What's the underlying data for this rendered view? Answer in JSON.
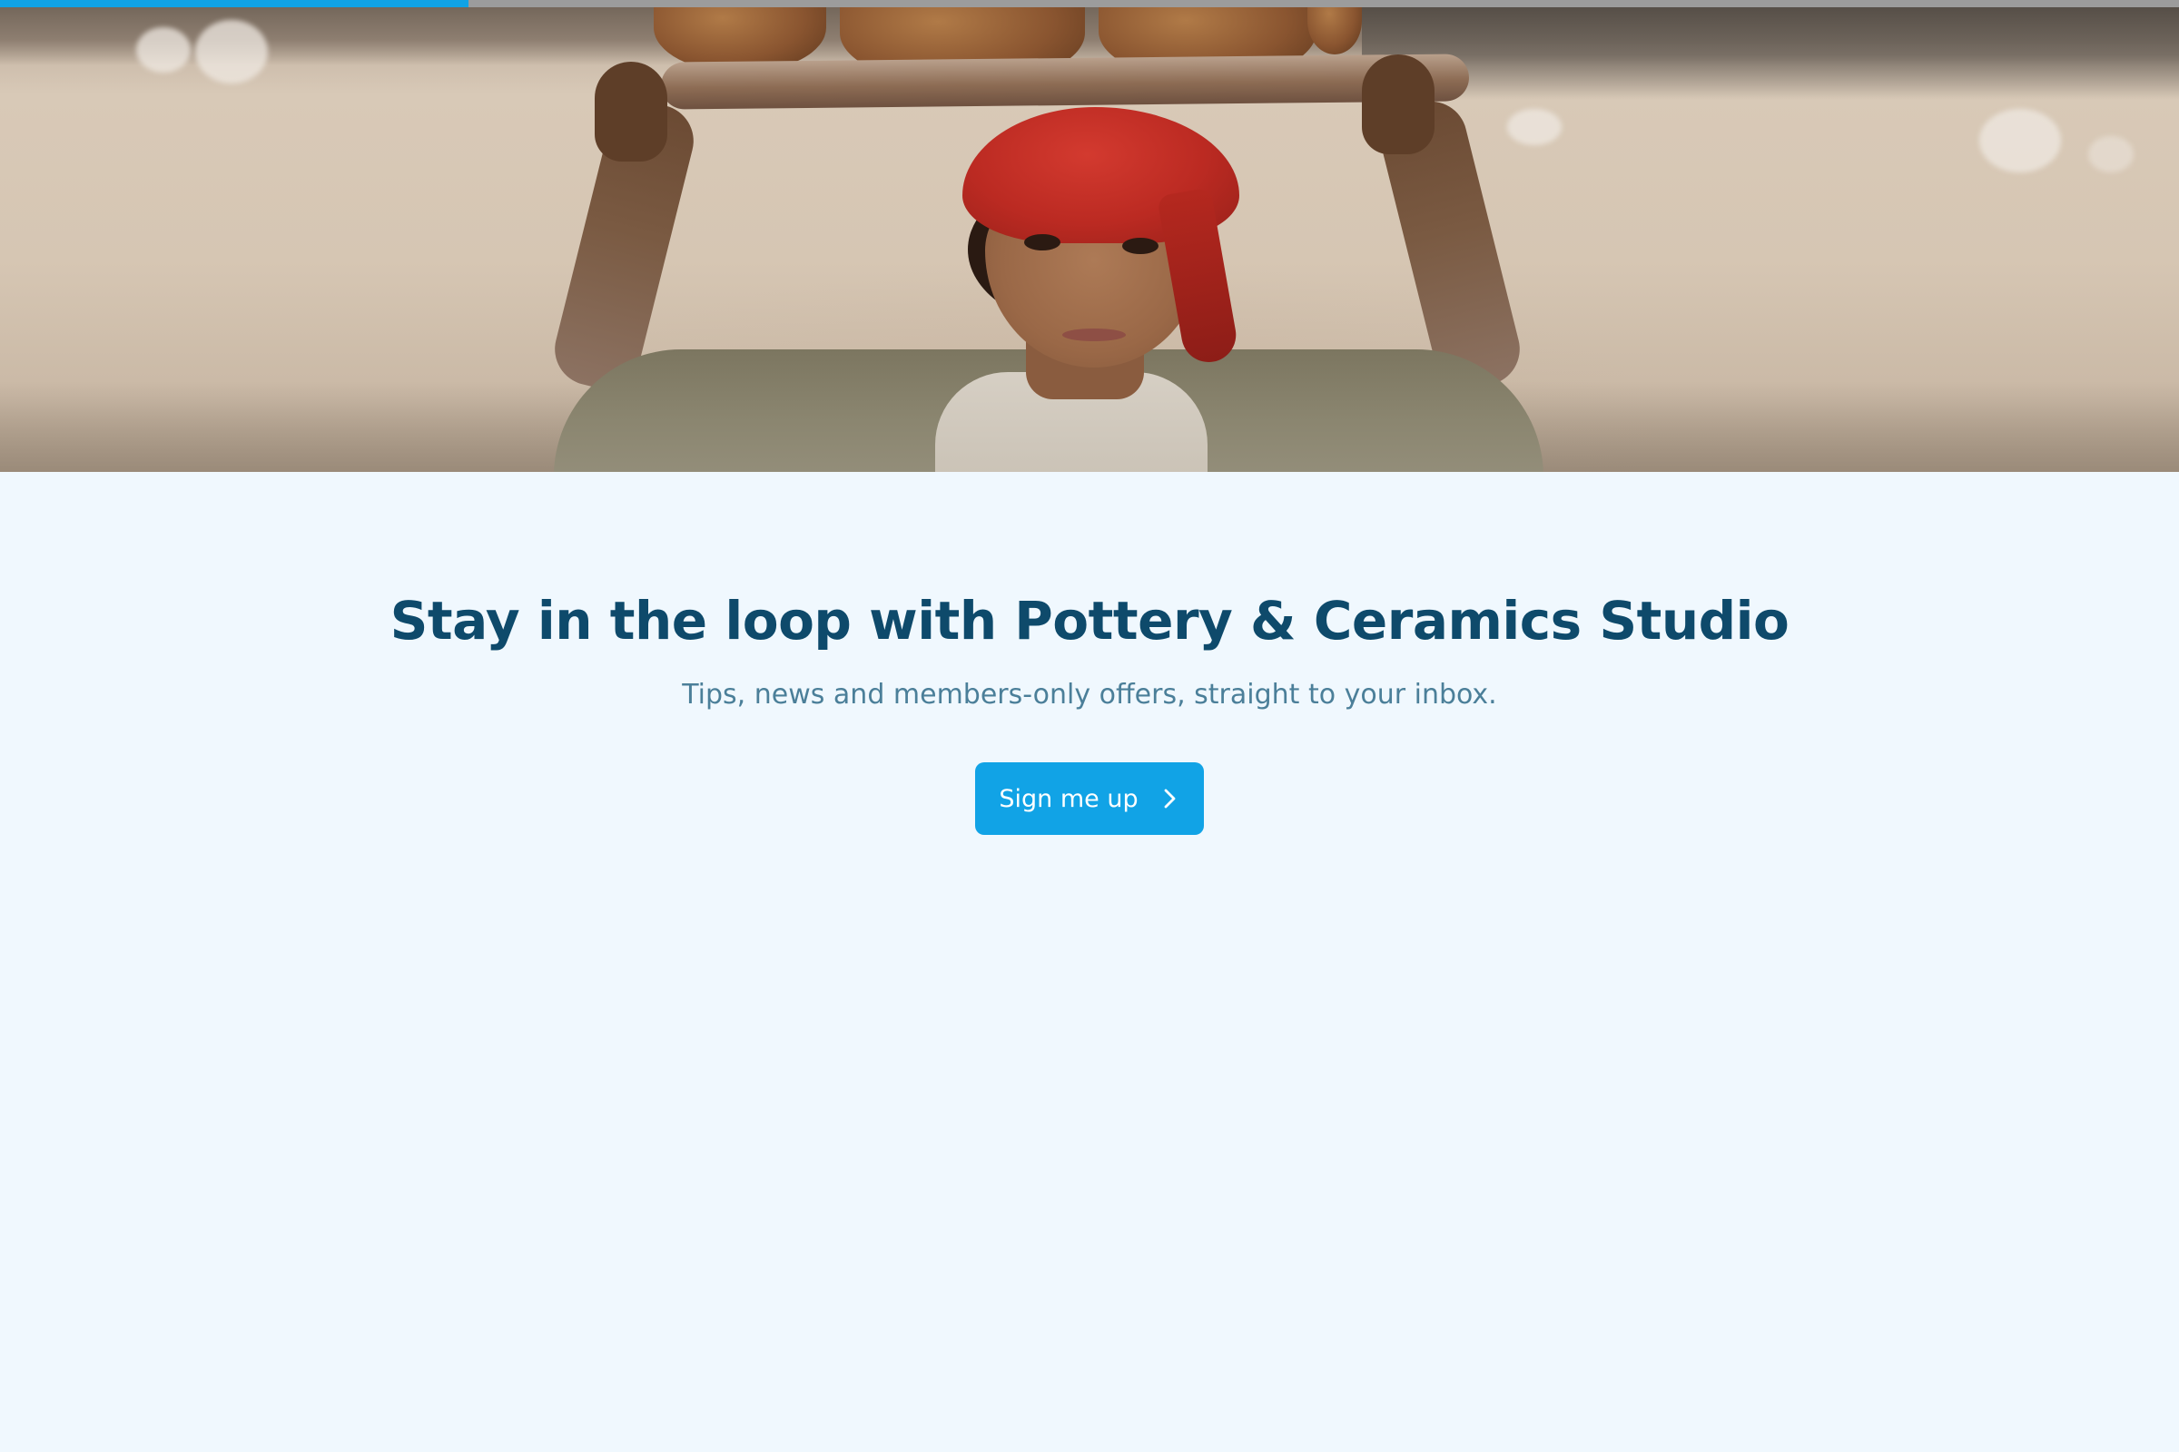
{
  "progress": {
    "value": 0.215,
    "color": "#11a3e6"
  },
  "hero_image": {
    "icon": "hero-photo"
  },
  "newsletter": {
    "headline": "Stay in the loop with Pottery & Ceramics Studio",
    "subheadline": "Tips, news and members-only offers, straight to your inbox.",
    "cta_label": "Sign me up",
    "cta_icon": "chevron-right-icon",
    "colors": {
      "background": "#f0f8fe",
      "headline": "#0e4a6b",
      "subheadline": "#4b7f99",
      "button": "#11a3e6",
      "button_text": "#ffffff"
    }
  }
}
